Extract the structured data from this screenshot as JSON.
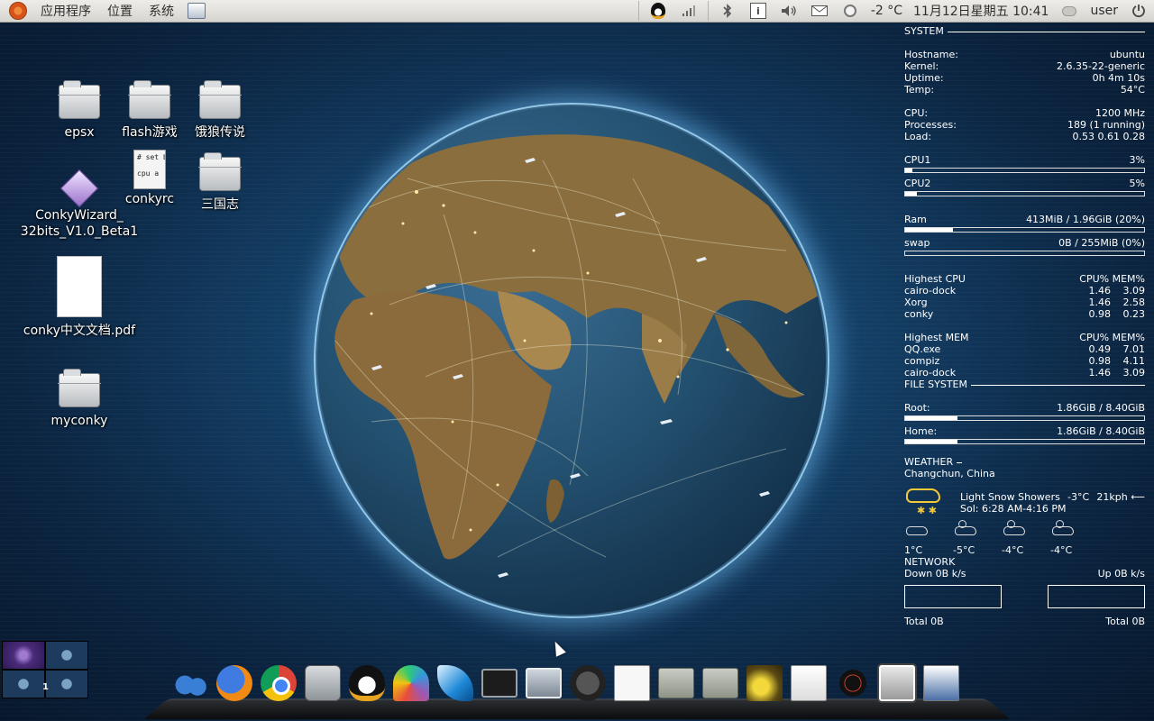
{
  "top_panel": {
    "menus": [
      "应用程序",
      "位置",
      "系统"
    ],
    "weather_temp": "-2 °C",
    "datetime": "11月12日星期五 10:41",
    "username": "user"
  },
  "desktop_icons": {
    "epsx": "epsx",
    "flash": "flash游戏",
    "elang": "饿狼传说",
    "conkyrc": "conkyrc",
    "conkyrc_preview": "# set backg\n\ncpu a",
    "sanguozhi": "三国志",
    "wizard_line1": "ConkyWizard_",
    "wizard_line2": "32bits_V1.0_Beta1",
    "pdf": "conky中文文档.pdf",
    "myconky": "myconky"
  },
  "conky": {
    "system_title": "SYSTEM",
    "hostname_label": "Hostname:",
    "hostname": "ubuntu",
    "kernel_label": "Kernel:",
    "kernel": "2.6.35-22-generic",
    "uptime_label": "Uptime:",
    "uptime": "0h 4m 10s",
    "temp_label": "Temp:",
    "temp": "54°C",
    "cpu_label": "CPU:",
    "cpu": "1200 MHz",
    "processes_label": "Processes:",
    "processes": "189 (1 running)",
    "load_label": "Load:",
    "load": "0.53 0.61 0.28",
    "cpu1_label": "CPU1",
    "cpu1": "3%",
    "cpu1_level": 0.03,
    "cpu2_label": "CPU2",
    "cpu2": "5%",
    "cpu2_level": 0.05,
    "ram_label": "Ram",
    "ram": "413MiB / 1.96GiB (20%)",
    "ram_level": 0.2,
    "swap_label": "swap",
    "swap": "0B  / 255MiB (0%)",
    "swap_level": 0.0,
    "highest_cpu_title": "Highest CPU",
    "col_header": "CPU% MEM%",
    "top_cpu": [
      {
        "name": "cairo-dock",
        "cpu": "1.46",
        "mem": "3.09"
      },
      {
        "name": "Xorg",
        "cpu": "1.46",
        "mem": "2.58"
      },
      {
        "name": "conky",
        "cpu": "0.98",
        "mem": "0.23"
      }
    ],
    "highest_mem_title": "Highest MEM",
    "top_mem": [
      {
        "name": "QQ.exe",
        "cpu": "0.49",
        "mem": "7.01"
      },
      {
        "name": "compiz",
        "cpu": "0.98",
        "mem": "4.11"
      },
      {
        "name": "cairo-dock",
        "cpu": "1.46",
        "mem": "3.09"
      }
    ],
    "fs_title": "FILE SYSTEM",
    "root_label": "Root:",
    "root": "1.86GiB / 8.40GiB",
    "root_level": 0.22,
    "home_label": "Home:",
    "home": "1.86GiB / 8.40GiB",
    "home_level": 0.22,
    "weather_title": "WEATHER",
    "location": "Changchun, China",
    "condition": "Light Snow Showers",
    "now_temp": "-3°C",
    "wind": "21kph",
    "wind_arrow": "⟵",
    "sol": "Sol: 6:28 AM-4:16 PM",
    "forecast": [
      "1°C",
      "-5°C",
      "-4°C",
      "-4°C"
    ],
    "network_title": "NETWORK",
    "down": "Down 0B  k/s",
    "up": "Up 0B  k/s",
    "total_down": "Total 0B",
    "total_up": "Total 0B"
  },
  "workspaces": {
    "current_label": "1"
  },
  "dock_items": [
    "feet-icon",
    "firefox-icon",
    "chrome-icon",
    "calculator-icon",
    "qq-icon",
    "fan-icon",
    "feather-icon",
    "terminal-icon",
    "window-icon",
    "gnome-icon",
    "menu-icon",
    "folder-icon",
    "download-folder-icon",
    "photo-icon",
    "text-editor-icon",
    "umbrella-icon",
    "trash-icon",
    "screenshot-icon"
  ]
}
